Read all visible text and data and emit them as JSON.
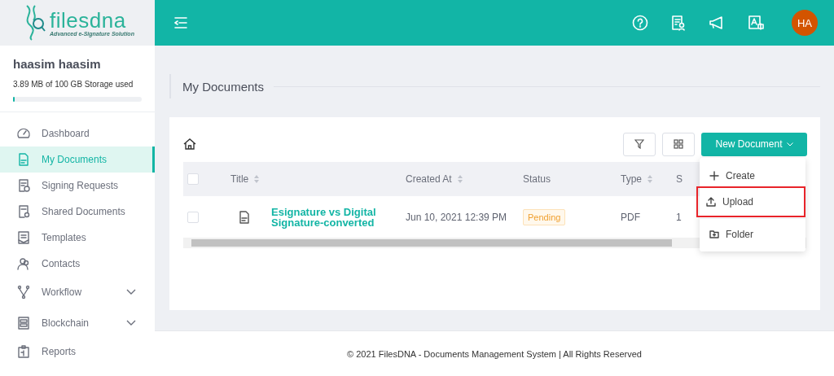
{
  "logo": {
    "name": "filesdna",
    "tagline": "Advanced e-Signature Solution"
  },
  "user": {
    "name": "haasim haasim",
    "storage": "3.89 MB of 100 GB Storage used",
    "level": 0.01
  },
  "sidebar": {
    "items": [
      {
        "label": "Dashboard",
        "kind": "gauge",
        "selected": false
      },
      {
        "label": "My Documents",
        "kind": "doc",
        "selected": true
      },
      {
        "label": "Signing Requests",
        "kind": "sign",
        "selected": false
      },
      {
        "label": "Shared Documents",
        "kind": "share",
        "selected": false
      },
      {
        "label": "Templates",
        "kind": "template",
        "selected": false
      },
      {
        "label": "Contacts",
        "kind": "contacts",
        "selected": false
      },
      {
        "label": "Workflow",
        "kind": "workflow",
        "selected": false,
        "expanded": false
      },
      {
        "label": "Blockchain",
        "kind": "chain",
        "selected": false,
        "expanded": false
      },
      {
        "label": "Reports",
        "kind": "reports",
        "selected": false
      }
    ]
  },
  "header": {
    "avatar": "HA"
  },
  "page_title": "My Documents",
  "toolbar": {
    "new_button": "New Document"
  },
  "menu": [
    {
      "label": "Create",
      "kind": "plus",
      "highlighted": false
    },
    {
      "label": "Upload",
      "kind": "upload",
      "highlighted": true
    },
    {
      "label": "Folder",
      "kind": "folder",
      "highlighted": false
    }
  ],
  "table": {
    "select_all": {
      "checked": false
    },
    "columns": [
      {
        "label": "Title",
        "sortable": true
      },
      {
        "label": "Created At",
        "sortable": true
      },
      {
        "label": "Status",
        "sortable": false
      },
      {
        "label": "Type",
        "sortable": true
      },
      {
        "label": "S",
        "sortable": false
      }
    ],
    "rows": [
      {
        "checked": false,
        "title": "Esignature vs Digital Signature-converted",
        "created": "Jun 10, 2021 12:39 PM",
        "status": "Pending",
        "type": "PDF",
        "column_5": "1"
      }
    ]
  },
  "footer": "© 2021 FilesDNA - Documents Management System | All Rights Reserved"
}
